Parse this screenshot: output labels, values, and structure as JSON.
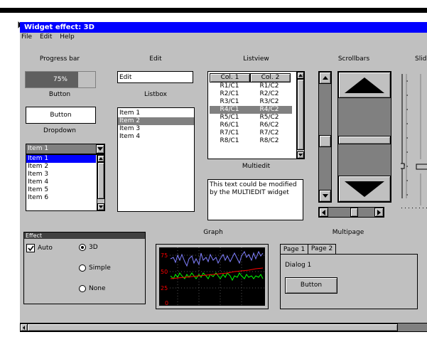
{
  "window": {
    "title": "Widget effect: 3D"
  },
  "menu": {
    "file": "File",
    "edit": "Edit",
    "help": "Help"
  },
  "labels": {
    "progress": "Progress bar",
    "edit": "Edit",
    "listview": "Listview",
    "scrollbars": "Scrollbars",
    "slider": "Slid",
    "button": "Button",
    "listbox": "Listbox",
    "dropdown": "Dropdown",
    "multiedit": "Multiedit",
    "graph": "Graph",
    "multipage": "Multipage"
  },
  "progress": {
    "text": "75%",
    "value": 0.75
  },
  "edit": {
    "value": "Edit"
  },
  "button": {
    "label": "Button"
  },
  "listbox": {
    "items": [
      "Item 1",
      "Item 2",
      "Item 3",
      "Item 4"
    ],
    "selected_index": 1
  },
  "dropdown": {
    "selected": "Item 1",
    "items": [
      "Item 1",
      "Item 2",
      "Item 3",
      "Item 4",
      "Item 5",
      "Item 6"
    ]
  },
  "listview": {
    "columns": [
      "Col. 1",
      "Col. 2"
    ],
    "rows": [
      [
        "R1/C1",
        "R1/C2"
      ],
      [
        "R2/C1",
        "R2/C2"
      ],
      [
        "R3/C1",
        "R3/C2"
      ],
      [
        "R4/C1",
        "R4/C2"
      ],
      [
        "R5/C1",
        "R5/C2"
      ],
      [
        "R6/C1",
        "R6/C2"
      ],
      [
        "R7/C1",
        "R7/C2"
      ],
      [
        "R8/C1",
        "R8/C2"
      ]
    ],
    "selected_index": 3
  },
  "multiedit": {
    "text_line1": "This text could be modified",
    "text_line2": "by the MULTIEDIT widget"
  },
  "effect": {
    "title": "Effect",
    "auto_label": "Auto",
    "auto_checked": true,
    "options": [
      "3D",
      "Simple",
      "None"
    ],
    "selected": "3D"
  },
  "graph": {
    "ticks": [
      "75",
      "50",
      "25",
      "0"
    ]
  },
  "multipage": {
    "tabs": [
      "Page 1",
      "Page 2"
    ],
    "dialog_label": "Dialog 1",
    "button_label": "Button"
  }
}
